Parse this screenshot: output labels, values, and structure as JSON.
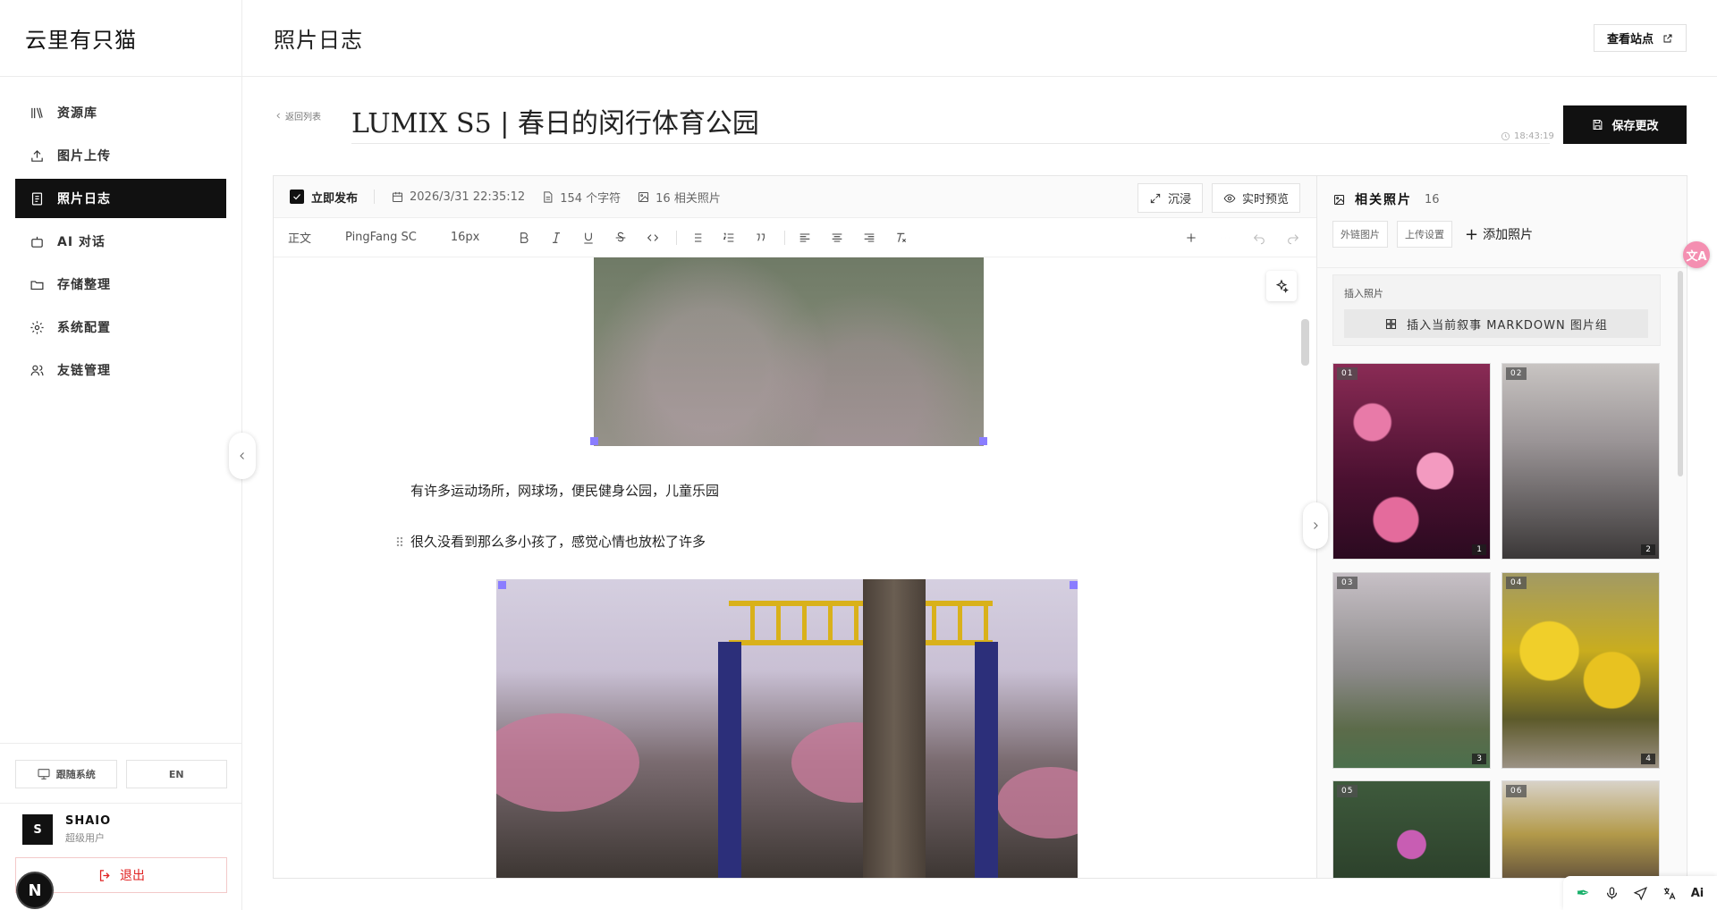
{
  "brand": "云里有只猫",
  "header": {
    "page_title": "照片日志",
    "view_site": "查看站点"
  },
  "sidebar": {
    "items": [
      {
        "label": "资源库",
        "icon": "library-icon"
      },
      {
        "label": "图片上传",
        "icon": "upload-icon"
      },
      {
        "label": "照片日志",
        "icon": "document-icon",
        "active": true
      },
      {
        "label": "AI 对话",
        "icon": "robot-icon"
      },
      {
        "label": "存储整理",
        "icon": "folder-icon"
      },
      {
        "label": "系统配置",
        "icon": "gear-icon"
      },
      {
        "label": "友链管理",
        "icon": "users-icon"
      }
    ],
    "theme_label": "跟随系统",
    "lang_label": "EN",
    "user": {
      "initial": "S",
      "name": "SHAIO",
      "role": "超级用户"
    },
    "logout_label": "退出",
    "badge": "N"
  },
  "post": {
    "back_label": "返回列表",
    "title": "LUMIX S5 | 春日的闵行体育公园",
    "save_time": "18:43:19",
    "save_label": "保存更改"
  },
  "meta": {
    "publish_label": "立即发布",
    "datetime": "2026/3/31 22:35:12",
    "char_count": "154 个字符",
    "photo_count": "16 相关照片",
    "immersive_label": "沉浸",
    "preview_label": "实时预览"
  },
  "toolbar": {
    "block_type": "正文",
    "font_family": "PingFang SC",
    "font_size": "16px"
  },
  "content": {
    "para1": "有许多运动场所，网球场，便民健身公园，儿童乐园",
    "para2": "很久没看到那么多小孩了，感觉心情也放松了许多"
  },
  "panel": {
    "title": "相关照片",
    "count": "16",
    "external_label": "外链图片",
    "upload_settings_label": "上传设置",
    "add_label": "添加照片",
    "insert_label": "插入照片",
    "insert_button": "插入当前叙事 MARKDOWN 图片组",
    "photos": [
      {
        "tag": "01",
        "num": "1"
      },
      {
        "tag": "02",
        "num": "2"
      },
      {
        "tag": "03",
        "num": "3"
      },
      {
        "tag": "04",
        "num": "4"
      },
      {
        "tag": "05",
        "num": ""
      },
      {
        "tag": "06",
        "num": ""
      }
    ]
  },
  "floating": {
    "translate_label": "文A",
    "tray_ai_label": "Ai"
  }
}
